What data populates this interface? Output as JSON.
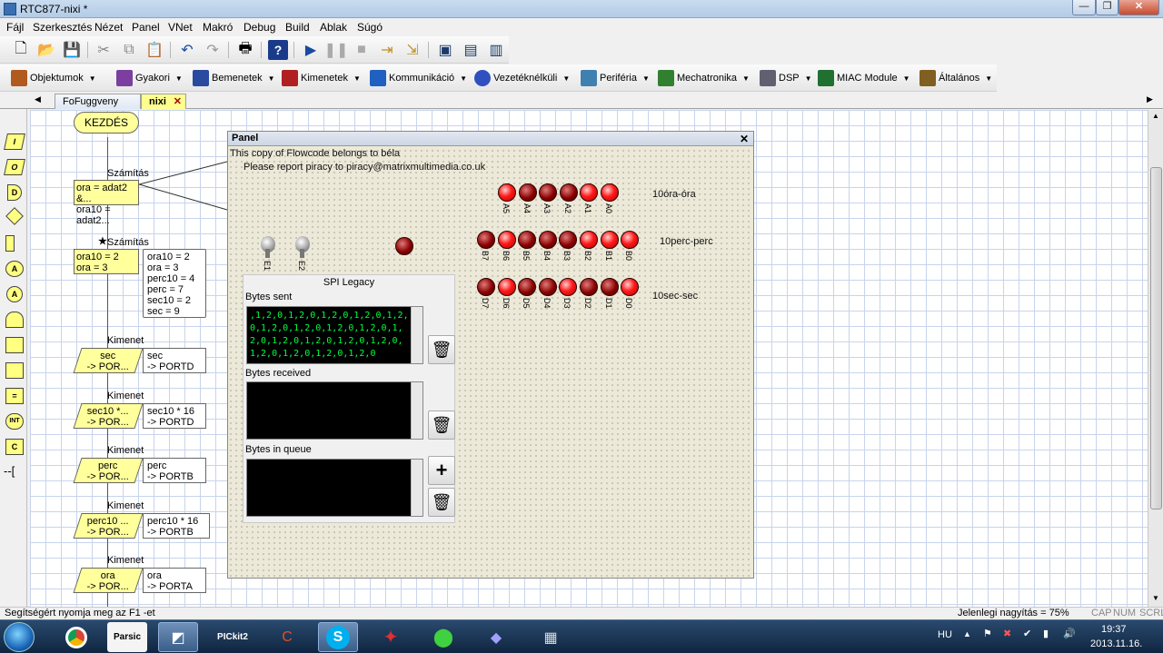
{
  "window": {
    "title": "RTC877-nixi *"
  },
  "menu": [
    "Fájl",
    "Szerkesztés",
    "Nézet",
    "Panel",
    "VNet",
    "Makró",
    "Debug",
    "Build",
    "Ablak",
    "Súgó"
  ],
  "components": [
    {
      "label": "Objektumok",
      "color": "#b05a20"
    },
    {
      "label": "Gyakori",
      "color": "#7a3fa0"
    },
    {
      "label": "Bemenetek",
      "color": "#2a4aa0"
    },
    {
      "label": "Kimenetek",
      "color": "#b02020"
    },
    {
      "label": "Kommunikáció",
      "color": "#2060c0"
    },
    {
      "label": "Vezetéknélküli",
      "color": "#3050c0"
    },
    {
      "label": "Periféria",
      "color": "#4080b0"
    },
    {
      "label": "Mechatronika",
      "color": "#308030"
    },
    {
      "label": "DSP",
      "color": "#606070"
    },
    {
      "label": "MIAC Module",
      "color": "#207030"
    },
    {
      "label": "Általános",
      "color": "#806020"
    }
  ],
  "tabs": [
    "FoFuggveny",
    "nixi"
  ],
  "flow": {
    "start": "KEZDÉS",
    "calc_label": "Számítás",
    "calc1_lines": [
      "ora = adat2 &...",
      "ora10 = adat2..."
    ],
    "calc2_lines": [
      "ora10 = 2",
      "ora = 3"
    ],
    "vars_lines": [
      "ora10 = 2",
      "ora = 3",
      "perc10 = 4",
      "perc = 7",
      "sec10 = 2",
      "sec = 9"
    ],
    "output_label": "Kimenet",
    "outputs": [
      {
        "box": [
          "sec",
          "-> POR..."
        ],
        "note": [
          "sec",
          "-> PORTD"
        ]
      },
      {
        "box": [
          "sec10 *...",
          "-> POR..."
        ],
        "note": [
          "sec10 * 16",
          "-> PORTD"
        ]
      },
      {
        "box": [
          "perc",
          "-> POR..."
        ],
        "note": [
          "perc",
          "-> PORTB"
        ]
      },
      {
        "box": [
          "perc10 ...",
          "-> POR..."
        ],
        "note": [
          "perc10 * 16",
          "-> PORTB"
        ]
      },
      {
        "box": [
          "ora",
          "-> POR..."
        ],
        "note": [
          "ora",
          "-> PORTA"
        ]
      }
    ]
  },
  "panel": {
    "title": "Panel",
    "copy_line": "This copy of Flowcode belongs to béla",
    "piracy_line": "Please report piracy to piracy@matrixmultimedia.co.uk",
    "row_a_label": "10óra-óra",
    "row_b_label": "10perc-perc",
    "row_d_label": "10sec-sec",
    "row_a": [
      {
        "name": "A5",
        "on": true
      },
      {
        "name": "A4",
        "on": false
      },
      {
        "name": "A3",
        "on": false
      },
      {
        "name": "A2",
        "on": false
      },
      {
        "name": "A1",
        "on": true
      },
      {
        "name": "A0",
        "on": true
      }
    ],
    "row_b": [
      {
        "name": "B7",
        "on": false
      },
      {
        "name": "B6",
        "on": true
      },
      {
        "name": "B5",
        "on": false
      },
      {
        "name": "B4",
        "on": false
      },
      {
        "name": "B3",
        "on": false
      },
      {
        "name": "B2",
        "on": true
      },
      {
        "name": "B1",
        "on": true
      },
      {
        "name": "B0",
        "on": true
      }
    ],
    "row_d": [
      {
        "name": "D7",
        "on": false
      },
      {
        "name": "D6",
        "on": true
      },
      {
        "name": "D5",
        "on": false
      },
      {
        "name": "D4",
        "on": false
      },
      {
        "name": "D3",
        "on": true
      },
      {
        "name": "D2",
        "on": false
      },
      {
        "name": "D1",
        "on": false
      },
      {
        "name": "D0",
        "on": true
      }
    ],
    "switches": [
      "E1",
      "E2"
    ],
    "spi": {
      "title": "SPI Legacy",
      "sent_label": "Bytes sent",
      "sent_text": ",1,2,0,1,2,0,1,2,0,1,2,0,1,2,0,1,2,0,1,2,0,1,2,0,1,2,0,1,2,0,1,2,0,1,2,0,1,2,0,1,2,0,1,2,0,1,2,0,1,2,0,1,2,0",
      "received_label": "Bytes received",
      "queue_label": "Bytes in queue"
    }
  },
  "status": {
    "help": "Segítségért nyomja meg az F1 -et",
    "zoom": "Jelenlegi nagyítás = 75%",
    "caps": "CAP",
    "num": "NUM",
    "scrl": "SCRL"
  },
  "taskbar": {
    "lang": "HU",
    "time": "19:37",
    "date": "2013.11.16."
  }
}
